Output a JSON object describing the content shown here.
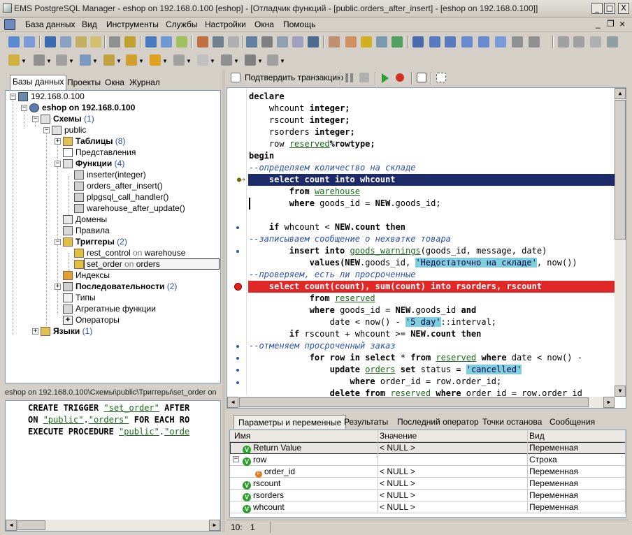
{
  "window": {
    "title": "EMS PostgreSQL Manager - eshop on 192.168.0.100 [eshop] - [Отладчик функций - [public.orders_after_insert] - [eshop on 192.168.0.100]]",
    "min_label": "_",
    "max_label": "□",
    "close_label": "X",
    "mdi_min": "_",
    "mdi_restore": "❐",
    "mdi_close": "×"
  },
  "menu": [
    "База данных",
    "Вид",
    "Инструменты",
    "Службы",
    "Настройки",
    "Окна",
    "Помощь"
  ],
  "left_tabs": [
    "Базы данных",
    "Проекты",
    "Окна",
    "Журнал"
  ],
  "tree": {
    "host": "192.168.0.100",
    "db": "eshop on 192.168.0.100",
    "schemas": "Схемы",
    "schemas_count": "(1)",
    "public": "public",
    "tables": "Таблицы",
    "tables_count": "(8)",
    "views": "Представления",
    "functions": "Функции",
    "functions_count": "(4)",
    "func_items": [
      "inserter(integer)",
      "orders_after_insert()",
      "plpgsql_call_handler()",
      "warehouse_after_update()"
    ],
    "domains": "Домены",
    "rules": "Правила",
    "triggers": "Триггеры",
    "triggers_count": "(2)",
    "trg1": "rest_control",
    "trg1_on": "on",
    "trg1_tbl": "warehouse",
    "trg2": "set_order",
    "trg2_on": "on",
    "trg2_tbl": "orders",
    "indexes": "Индексы",
    "sequences": "Последовательности",
    "sequences_count": "(2)",
    "types": "Типы",
    "aggregates": "Агрегатные функции",
    "operators": "Операторы",
    "languages": "Языки",
    "languages_count": "(1)"
  },
  "path_bar": "eshop on 192.168.0.100\\Схемы\\public\\Триггеры\\set_order on",
  "sql": {
    "l1_kw": "CREATE TRIGGER",
    "l1_str": "\"set_order\"",
    "l1_tail": "AFTER",
    "l2_kw": "ON",
    "l2_s1": "\"public\"",
    "l2_dot": ".",
    "l2_s2": "\"orders\"",
    "l2_tail": "FOR EACH RO",
    "l3_kw": "EXECUTE PROCEDURE",
    "l3_s1": "\"public\"",
    "l3_dot": ".",
    "l3_s2": "\"orde"
  },
  "debug_toolbar": {
    "commit_label": "Подтвердить транзакцию"
  },
  "code": {
    "declare": "declare",
    "v1_name": "    whcount",
    "v1_type": "integer;",
    "v2_name": "    rscount",
    "v2_type": "integer;",
    "v3_name": "    rsorders",
    "v3_type": "integer;",
    "v4_name": "    row",
    "v4_ref": "reserved",
    "v4_tail": "%rowtype;",
    "begin": "begin",
    "c1": "--определяем количество на складе",
    "hl1": "    select count into whcount",
    "from1": "from",
    "from1_tbl": "warehouse",
    "where1": "where",
    "where1_tail": "goods_id = ",
    "new1": "NEW",
    "where1_end": ".goods_id;",
    "if1": "if",
    "if1_mid": "whcount < ",
    "if1_new": "NEW",
    "if1_tail": ".count",
    "if1_then": "then",
    "c2": "--записываем сообщение о нехватке товара",
    "ins": "insert into",
    "ins_tbl": "goods_warnings",
    "ins_tail": "(goods_id, message, date)",
    "values_kw": "values",
    "values_new": "(NEW",
    "values_mid": ".goods_id,",
    "values_lit": "'Недостаточно на складе'",
    "values_tail": ", now())",
    "c3": "--проверяем, есть ли просроченные",
    "hl2": "    select count(count), sum(count) into rsorders, rscount",
    "from2": "from",
    "from2_tbl": "reserved",
    "where2": "where",
    "where2_mid": "goods_id = ",
    "where2_new": "NEW",
    "where2_tail": ".goods_id",
    "and_kw": "and",
    "date_line": "date < now() - ",
    "date_lit": "'5 day'",
    "date_tail": "::interval;",
    "if2": "if",
    "if2_mid": "rscount + whcount >= ",
    "if2_new": "NEW",
    "if2_tail": ".count",
    "if2_then": "then",
    "c4": "--отменяем просроченный заказ",
    "for_kw": "for",
    "for_mid": "row",
    "in_kw": "in select",
    "star": " * ",
    "from3": "from",
    "for_tbl": "reserved",
    "where3": "where",
    "for_tail": "date < now() -",
    "upd_kw": "update",
    "upd_tbl": "orders",
    "set_kw": "set",
    "set_mid": "status = ",
    "upd_lit": "'cancelled'",
    "where4": "where",
    "where4_tail": "order_id = row.order_id;",
    "del_kw": "delete from",
    "del_tbl": "reserved",
    "where5": "where",
    "del_tail": "order id = row.order id"
  },
  "bottom_tabs": [
    "Параметры и переменные",
    "Результаты",
    "Последний оператор",
    "Точки останова",
    "Сообщения"
  ],
  "grid": {
    "headers": [
      "Имя",
      "Значение",
      "Вид"
    ],
    "rows": [
      {
        "name": "Return Value",
        "value": "< NULL >",
        "kind": "Переменная",
        "icon": "V"
      },
      {
        "name": "row",
        "value": "",
        "kind": "Строка",
        "icon": "V"
      },
      {
        "name": "order_id",
        "value": "< NULL >",
        "kind": "Переменная",
        "icon": "F"
      },
      {
        "name": "rscount",
        "value": "< NULL >",
        "kind": "Переменная",
        "icon": "V"
      },
      {
        "name": "rsorders",
        "value": "< NULL >",
        "kind": "Переменная",
        "icon": "V"
      },
      {
        "name": "whcount",
        "value": "< NULL >",
        "kind": "Переменная",
        "icon": "V"
      }
    ]
  },
  "status": {
    "line": "10:",
    "col": "1"
  },
  "colors": {
    "exec_line": "#1c2a6a",
    "breakpoint_line": "#e02828",
    "comment": "#2a4fb0",
    "string": "#1a6a1a"
  }
}
